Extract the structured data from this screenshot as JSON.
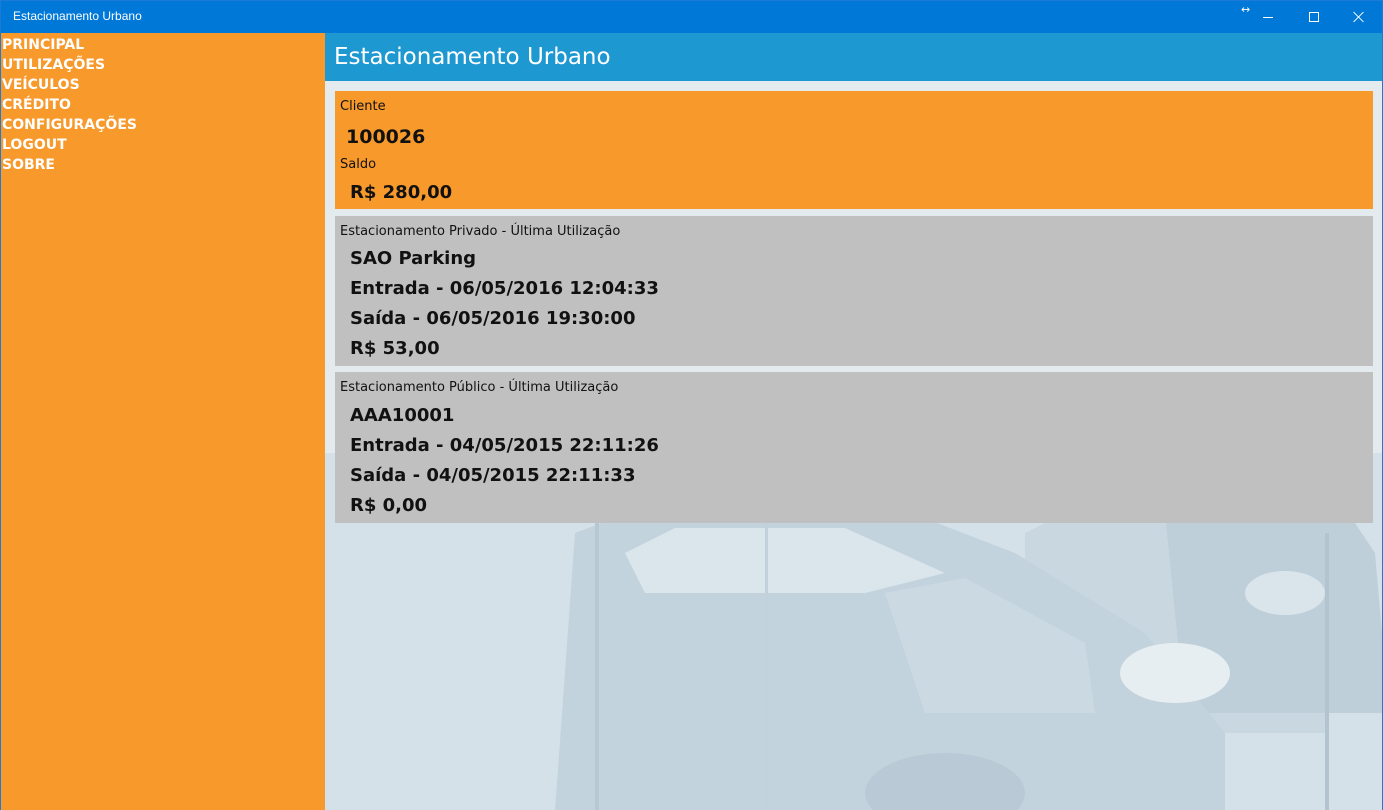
{
  "window": {
    "title": "Estacionamento Urbano",
    "resize_glyph": "↔",
    "controls": [
      "minimize-icon",
      "maximize-icon",
      "close-icon"
    ]
  },
  "sidebar": {
    "items": [
      {
        "label": "PRINCIPAL"
      },
      {
        "label": "UTILIZAÇÕES"
      },
      {
        "label": "VEÍCULOS"
      },
      {
        "label": "CRÉDITO"
      },
      {
        "label": "CONFIGURAÇÕES"
      },
      {
        "label": "LOGOUT"
      },
      {
        "label": "SOBRE"
      }
    ]
  },
  "header": {
    "title": "Estacionamento Urbano"
  },
  "client_card": {
    "client_label": "Cliente",
    "client_id": "100026",
    "balance_label": "Saldo",
    "balance_value": "R$ 280,00"
  },
  "private_card": {
    "label": "Estacionamento Privado - Última Utilização",
    "name": "SAO Parking",
    "entrada": "Entrada - 06/05/2016 12:04:33",
    "saida": "Saída - 06/05/2016 19:30:00",
    "valor": "R$ 53,00"
  },
  "public_card": {
    "label": "Estacionamento Público - Última Utilização",
    "plate": "AAA10001",
    "entrada": "Entrada - 04/05/2015 22:11:26",
    "saida": "Saída - 04/05/2015 22:11:33",
    "valor": "R$ 0,00"
  },
  "colors": {
    "titlebar": "#0078d7",
    "sidebar": "#f7992b",
    "header": "#1e98d0",
    "card_orange": "#f7992b",
    "card_gray": "#c0c0c0"
  }
}
